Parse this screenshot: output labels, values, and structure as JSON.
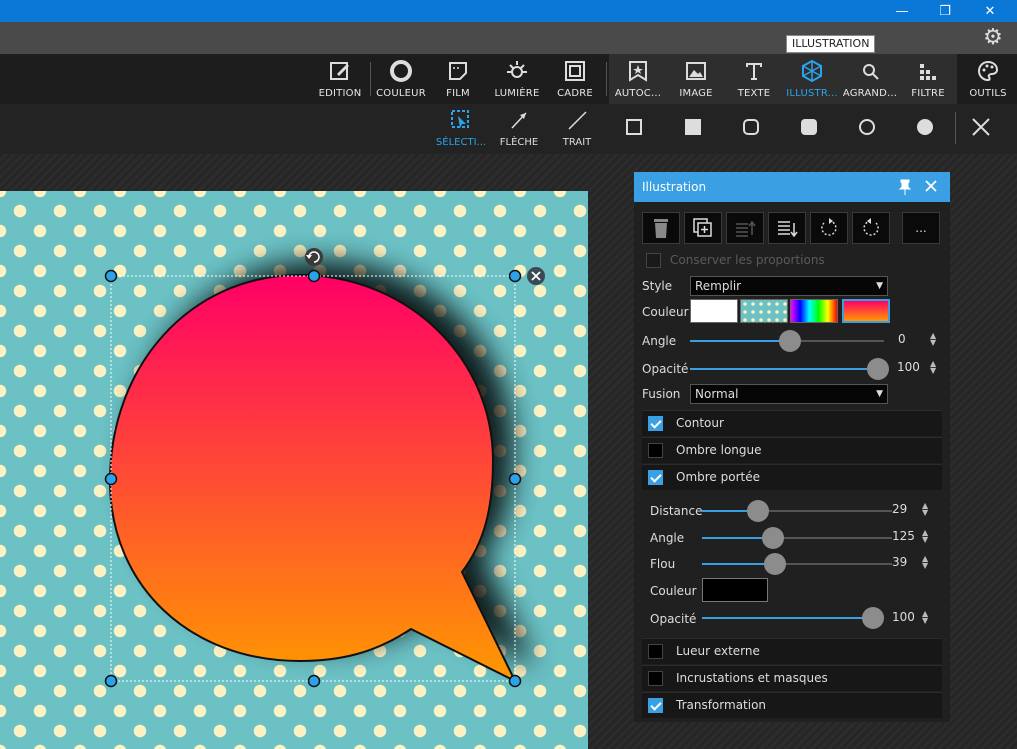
{
  "window": {
    "minimize": "—",
    "restore": "❐",
    "close": "✕"
  },
  "tooltip": "ILLUSTRATION",
  "toolbar": {
    "items": [
      {
        "label": "EDITION",
        "icon": "edit-icon"
      },
      {
        "label": "COULEUR",
        "icon": "circle-icon"
      },
      {
        "label": "FILM",
        "icon": "film-icon"
      },
      {
        "label": "LUMIÈRE",
        "icon": "sun-icon"
      },
      {
        "label": "CADRE",
        "icon": "frame-icon"
      },
      {
        "label": "AUTOC...",
        "icon": "star-frame-icon"
      },
      {
        "label": "IMAGE",
        "icon": "image-icon"
      },
      {
        "label": "TEXTE",
        "icon": "text-icon"
      },
      {
        "label": "ILLUSTR...",
        "icon": "hexagon-icon"
      },
      {
        "label": "AGRAND...",
        "icon": "zoom-icon"
      },
      {
        "label": "FILTRE",
        "icon": "filter-icon"
      },
      {
        "label": "OUTILS",
        "icon": "palette-icon"
      }
    ]
  },
  "subtoolbar": {
    "select": "SÉLECTI...",
    "arrow": "FLÈCHE",
    "line": "TRAIT"
  },
  "panel": {
    "title": "Illustration",
    "keep_proportions": "Conserver les proportions",
    "more": "...",
    "style_label": "Style",
    "style_value": "Remplir",
    "color_label": "Couleur",
    "angle_label": "Angle",
    "angle_value": "0",
    "opacity_label": "Opacité",
    "opacity_value": "100",
    "fusion_label": "Fusion",
    "fusion_value": "Normal",
    "sections": {
      "contour": "Contour",
      "long_shadow": "Ombre longue",
      "drop_shadow": "Ombre portée",
      "outer_glow": "Lueur externe",
      "inlays": "Incrustations et masques",
      "transform": "Transformation"
    },
    "shadow": {
      "distance_label": "Distance",
      "distance_value": "29",
      "angle_label": "Angle",
      "angle_value": "125",
      "blur_label": "Flou",
      "blur_value": "39",
      "color_label": "Couleur",
      "opacity_label": "Opacité",
      "opacity_value": "100"
    }
  },
  "colors": {
    "accent": "#3aa0e3",
    "gradient_top": "#ff0066",
    "gradient_bottom": "#ff9900",
    "canvas_bg": "#6bc1c4",
    "dot": "#fbf1c3"
  }
}
